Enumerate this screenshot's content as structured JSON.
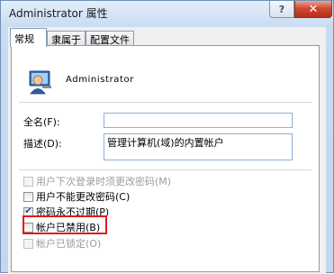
{
  "window": {
    "title": "Administrator 属性",
    "help_label": "?",
    "close_label": "✕"
  },
  "tabs": [
    {
      "label": "常规"
    },
    {
      "label": "隶属于"
    },
    {
      "label": "配置文件"
    }
  ],
  "general": {
    "username": "Administrator",
    "fullname_label": "全名(F):",
    "fullname_value": "",
    "description_label": "描述(D):",
    "description_value": "管理计算机(域)的内置帐户"
  },
  "options": [
    {
      "label": "用户下次登录时须更改密码(M)",
      "checked": false,
      "disabled": true
    },
    {
      "label": "用户不能更改密码(C)",
      "checked": false,
      "disabled": false
    },
    {
      "label": "密码永不过期(P)",
      "checked": true,
      "disabled": false
    },
    {
      "label": "帐户已禁用(B)",
      "checked": false,
      "disabled": false,
      "highlighted": true
    },
    {
      "label": "帐户已锁定(O)",
      "checked": false,
      "disabled": true
    }
  ],
  "colors": {
    "highlight_border": "#e01b1b",
    "close_button": "#c7432c"
  }
}
